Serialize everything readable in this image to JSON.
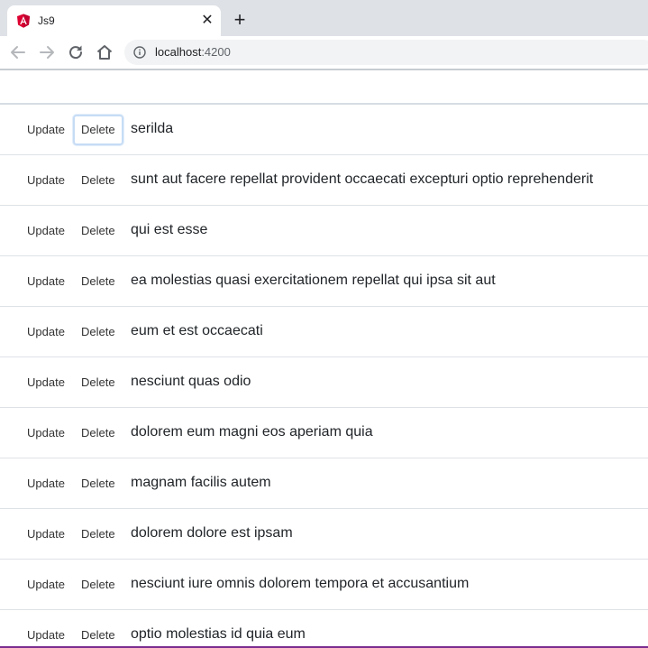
{
  "browser": {
    "tab": {
      "title": "Js9",
      "favicon": "angular-logo-icon",
      "close": "✕"
    },
    "new_tab": "+",
    "address": {
      "host": "localhost",
      "port": ":4200"
    },
    "icons": {
      "back": "arrow-left-icon",
      "forward": "arrow-right-icon",
      "reload": "reload-icon",
      "home": "home-icon",
      "info": "info-icon"
    },
    "colors": {
      "tabstrip": "#dee1e6",
      "angular_red": "#dd0031",
      "focus_ring": "#c6dcf5"
    }
  },
  "list": {
    "update_label": "Update",
    "delete_label": "Delete",
    "items": [
      {
        "title": "serilda"
      },
      {
        "title": "sunt aut facere repellat provident occaecati excepturi optio reprehenderit"
      },
      {
        "title": "qui est esse"
      },
      {
        "title": "ea molestias quasi exercitationem repellat qui ipsa sit aut"
      },
      {
        "title": "eum et est occaecati"
      },
      {
        "title": "nesciunt quas odio"
      },
      {
        "title": "dolorem eum magni eos aperiam quia"
      },
      {
        "title": "magnam facilis autem"
      },
      {
        "title": "dolorem dolore est ipsam"
      },
      {
        "title": "nesciunt iure omnis dolorem tempora et accusantium"
      },
      {
        "title": "optio molestias id quia eum"
      }
    ]
  }
}
